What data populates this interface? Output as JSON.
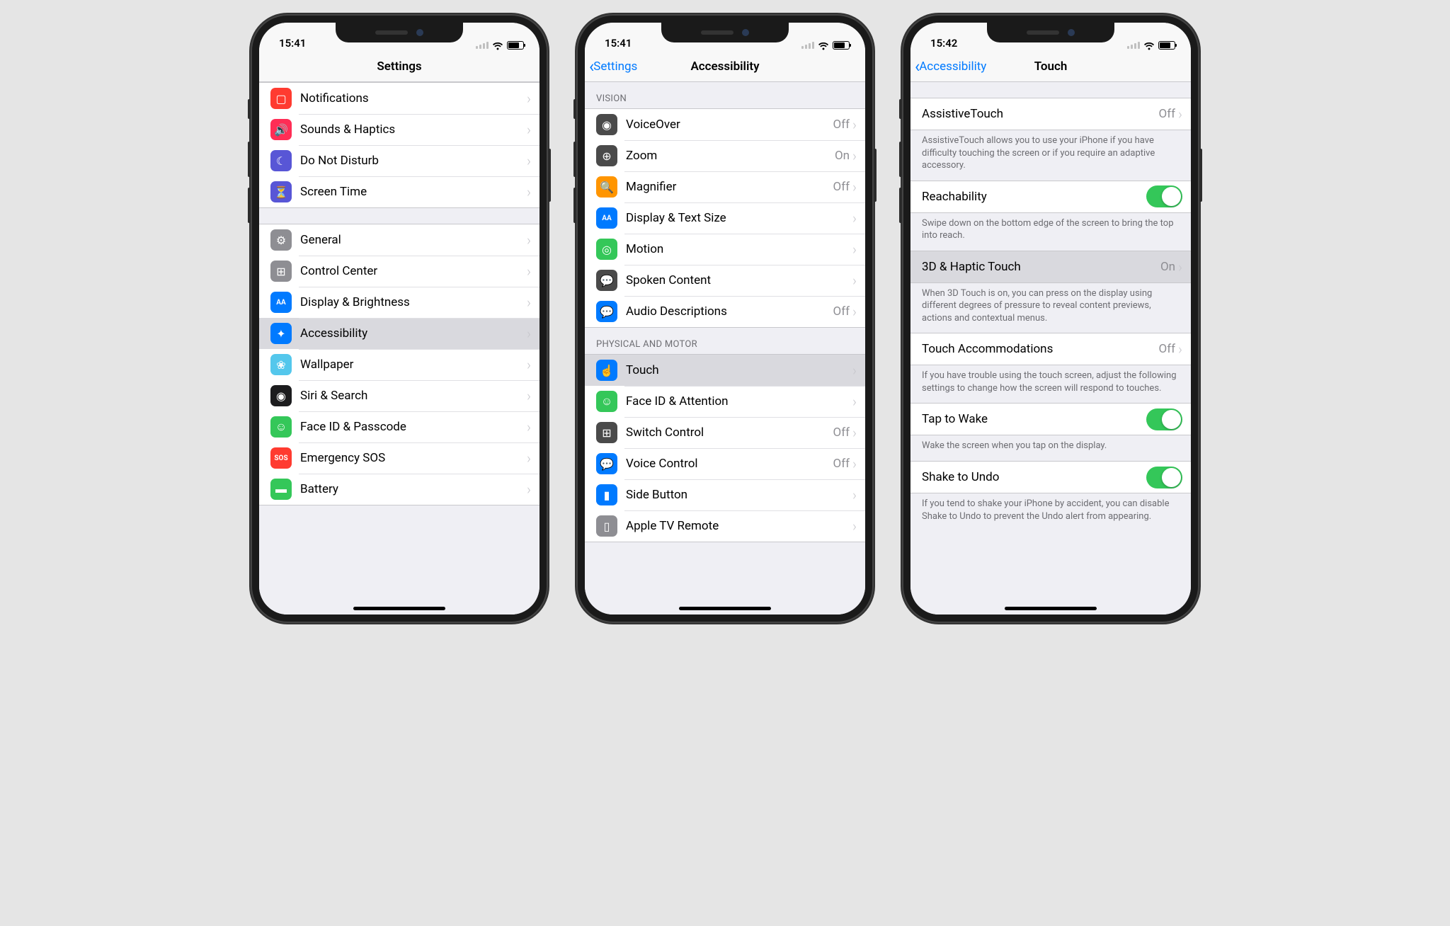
{
  "phones": [
    {
      "time": "15:41",
      "title": "Settings",
      "back": null,
      "sections": [
        {
          "header": null,
          "rows": [
            {
              "icon": "notifications",
              "iconColor": "#ff3b30",
              "label": "Notifications",
              "value": null,
              "type": "nav"
            },
            {
              "icon": "sounds",
              "iconColor": "#ff2d55",
              "label": "Sounds & Haptics",
              "value": null,
              "type": "nav"
            },
            {
              "icon": "dnd",
              "iconColor": "#5856d6",
              "label": "Do Not Disturb",
              "value": null,
              "type": "nav"
            },
            {
              "icon": "screentime",
              "iconColor": "#5856d6",
              "label": "Screen Time",
              "value": null,
              "type": "nav"
            }
          ]
        },
        {
          "header": null,
          "rows": [
            {
              "icon": "general",
              "iconColor": "#8e8e93",
              "label": "General",
              "value": null,
              "type": "nav"
            },
            {
              "icon": "control",
              "iconColor": "#8e8e93",
              "label": "Control Center",
              "value": null,
              "type": "nav"
            },
            {
              "icon": "display",
              "iconColor": "#007aff",
              "label": "Display & Brightness",
              "value": null,
              "type": "nav"
            },
            {
              "icon": "accessibility",
              "iconColor": "#007aff",
              "label": "Accessibility",
              "value": null,
              "type": "nav",
              "selected": true
            },
            {
              "icon": "wallpaper",
              "iconColor": "#54c7ec",
              "label": "Wallpaper",
              "value": null,
              "type": "nav"
            },
            {
              "icon": "siri",
              "iconColor": "#1c1c1e",
              "label": "Siri & Search",
              "value": null,
              "type": "nav"
            },
            {
              "icon": "faceid",
              "iconColor": "#34c759",
              "label": "Face ID & Passcode",
              "value": null,
              "type": "nav"
            },
            {
              "icon": "sos",
              "iconColor": "#ff3b30",
              "label": "Emergency SOS",
              "value": null,
              "type": "nav"
            },
            {
              "icon": "battery",
              "iconColor": "#34c759",
              "label": "Battery",
              "value": null,
              "type": "nav"
            }
          ]
        }
      ]
    },
    {
      "time": "15:41",
      "title": "Accessibility",
      "back": "Settings",
      "sections": [
        {
          "header": "VISION",
          "rows": [
            {
              "icon": "voiceover",
              "iconColor": "#4a4a4a",
              "label": "VoiceOver",
              "value": "Off",
              "type": "nav"
            },
            {
              "icon": "zoom",
              "iconColor": "#4a4a4a",
              "label": "Zoom",
              "value": "On",
              "type": "nav"
            },
            {
              "icon": "magnifier",
              "iconColor": "#ff9500",
              "label": "Magnifier",
              "value": "Off",
              "type": "nav"
            },
            {
              "icon": "textsize",
              "iconColor": "#007aff",
              "label": "Display & Text Size",
              "value": null,
              "type": "nav"
            },
            {
              "icon": "motion",
              "iconColor": "#34c759",
              "label": "Motion",
              "value": null,
              "type": "nav"
            },
            {
              "icon": "spoken",
              "iconColor": "#4a4a4a",
              "label": "Spoken Content",
              "value": null,
              "type": "nav"
            },
            {
              "icon": "audiodesc",
              "iconColor": "#007aff",
              "label": "Audio Descriptions",
              "value": "Off",
              "type": "nav"
            }
          ]
        },
        {
          "header": "PHYSICAL AND MOTOR",
          "rows": [
            {
              "icon": "touch",
              "iconColor": "#007aff",
              "label": "Touch",
              "value": null,
              "type": "nav",
              "selected": true
            },
            {
              "icon": "faceatt",
              "iconColor": "#34c759",
              "label": "Face ID & Attention",
              "value": null,
              "type": "nav"
            },
            {
              "icon": "switch",
              "iconColor": "#4a4a4a",
              "label": "Switch Control",
              "value": "Off",
              "type": "nav"
            },
            {
              "icon": "voicectl",
              "iconColor": "#007aff",
              "label": "Voice Control",
              "value": "Off",
              "type": "nav"
            },
            {
              "icon": "sidebutton",
              "iconColor": "#007aff",
              "label": "Side Button",
              "value": null,
              "type": "nav"
            },
            {
              "icon": "appletv",
              "iconColor": "#8e8e93",
              "label": "Apple TV Remote",
              "value": null,
              "type": "nav"
            }
          ]
        }
      ]
    },
    {
      "time": "15:42",
      "title": "Touch",
      "back": "Accessibility",
      "sections": [
        {
          "header": null,
          "rows": [
            {
              "label": "AssistiveTouch",
              "value": "Off",
              "type": "nav",
              "noIcon": true
            }
          ],
          "footer": "AssistiveTouch allows you to use your iPhone if you have difficulty touching the screen or if you require an adaptive accessory."
        },
        {
          "header": null,
          "rows": [
            {
              "label": "Reachability",
              "type": "toggle",
              "on": true,
              "noIcon": true
            }
          ],
          "footer": "Swipe down on the bottom edge of the screen to bring the top into reach."
        },
        {
          "header": null,
          "rows": [
            {
              "label": "3D & Haptic Touch",
              "value": "On",
              "type": "nav",
              "noIcon": true,
              "selected": true
            }
          ],
          "footer": "When 3D Touch is on, you can press on the display using different degrees of pressure to reveal content previews, actions and contextual menus."
        },
        {
          "header": null,
          "rows": [
            {
              "label": "Touch Accommodations",
              "value": "Off",
              "type": "nav",
              "noIcon": true
            }
          ],
          "footer": "If you have trouble using the touch screen, adjust the following settings to change how the screen will respond to touches."
        },
        {
          "header": null,
          "rows": [
            {
              "label": "Tap to Wake",
              "type": "toggle",
              "on": true,
              "noIcon": true
            }
          ],
          "footer": "Wake the screen when you tap on the display."
        },
        {
          "header": null,
          "rows": [
            {
              "label": "Shake to Undo",
              "type": "toggle",
              "on": true,
              "noIcon": true
            }
          ],
          "footer": "If you tend to shake your iPhone by accident, you can disable Shake to Undo to prevent the Undo alert from appearing."
        }
      ]
    }
  ],
  "iconGlyphs": {
    "notifications": "▢",
    "sounds": "🔊",
    "dnd": "☾",
    "screentime": "⏳",
    "general": "⚙",
    "control": "⊞",
    "display": "AA",
    "accessibility": "✦",
    "wallpaper": "❀",
    "siri": "◉",
    "faceid": "☺",
    "sos": "SOS",
    "battery": "▬",
    "voiceover": "◉",
    "zoom": "⊕",
    "magnifier": "🔍",
    "textsize": "AA",
    "motion": "◎",
    "spoken": "💬",
    "audiodesc": "💬",
    "touch": "☝",
    "faceatt": "☺",
    "switch": "⊞",
    "voicectl": "💬",
    "sidebutton": "▮",
    "appletv": "▯"
  }
}
